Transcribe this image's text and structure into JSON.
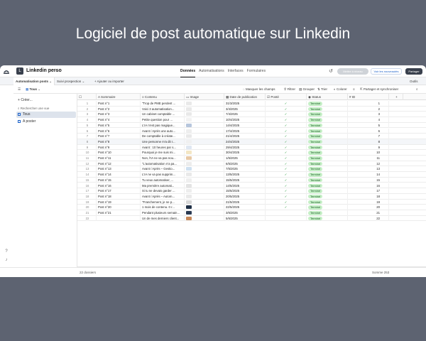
{
  "slide": {
    "title": "Logiciel de post automatique sur Linkedin"
  },
  "topbar": {
    "base_icon": "L",
    "base_name": "Linkedin perso",
    "nav": [
      "Données",
      "Automatisations",
      "Interfaces",
      "Formulaires"
    ],
    "new_button": "Mettre à niveau",
    "news_button": "Voir les nouveautés",
    "share_button": "Partager"
  },
  "tabs": {
    "items": [
      "Automatisation posts",
      "Suivi prospection",
      "Ajouter ou importer"
    ],
    "tools": "Outils"
  },
  "viewbar": {
    "view_name": "Tous",
    "hide_fields": "Masquer les champs",
    "filter": "Filtrer",
    "group": "Grouper",
    "sort": "Trier",
    "color": "Colorer",
    "share_sync": "Partager et synchroniser"
  },
  "sidebar": {
    "create": "Créer...",
    "search": "Rechercher une vue",
    "views": [
      "Tous",
      "A poster"
    ]
  },
  "grid": {
    "headers": [
      "Sommaire",
      "Contenu",
      "Image",
      "Date de publication",
      "Posté",
      "Status",
      "ID"
    ],
    "rows": [
      {
        "n": "1",
        "title": "Post n°1",
        "content": "\"Trop de PME perdent ...",
        "date": "31/3/2025",
        "posted": true,
        "status": "Terminé",
        "id": "1",
        "thumb": "#e9e9e9"
      },
      {
        "n": "2",
        "title": "Post n°2",
        "content": "Voici 3 automatisation...",
        "date": "3/4/2025",
        "posted": true,
        "status": "Terminé",
        "id": "2",
        "thumb": "#e9e9e9"
      },
      {
        "n": "3",
        "title": "Post n°3",
        "content": "Un cabinet comptable ...",
        "date": "7/4/2025",
        "posted": true,
        "status": "Terminé",
        "id": "3",
        "thumb": "#e9e9e9"
      },
      {
        "n": "4",
        "title": "Post n°4",
        "content": "Petite question pour ...",
        "date": "10/4/2025",
        "posted": true,
        "status": "Terminé",
        "id": "4",
        "thumb": "#f2f2f2"
      },
      {
        "n": "5",
        "title": "Post n°5",
        "content": "L'IA n'est pas magique...",
        "date": "14/4/2025",
        "posted": true,
        "status": "Terminé",
        "id": "5",
        "thumb": "#b7c6dd"
      },
      {
        "n": "6",
        "title": "Post n°6",
        "content": "Avant / Après une auto...",
        "date": "17/4/2025",
        "posted": true,
        "status": "Terminé",
        "id": "6",
        "thumb": "#eeeeee"
      },
      {
        "n": "7",
        "title": "Post n°7",
        "content": "De comptable à créate...",
        "date": "21/4/2025",
        "posted": true,
        "status": "Terminé",
        "id": "7",
        "thumb": "#e9e9e9"
      },
      {
        "n": "8",
        "title": "Post n°8",
        "content": "Une personne m'a dit r...",
        "date": "24/4/2025",
        "posted": true,
        "status": "Terminé",
        "id": "8",
        "thumb": "#f0f0f0"
      },
      {
        "n": "9",
        "title": "Post n°9",
        "content": "Avant : 10 heures par s...",
        "date": "29/4/2025",
        "posted": true,
        "status": "Terminé",
        "id": "9",
        "thumb": "#dfe7f2"
      },
      {
        "n": "10",
        "title": "Post n°10",
        "content": "Pourquoi je me suis mi...",
        "date": "30/4/2025",
        "posted": true,
        "status": "Terminé",
        "id": "10",
        "thumb": "#f3e6c4"
      },
      {
        "n": "11",
        "title": "Post n°11",
        "content": "Non, l'IA ne va pas nou...",
        "date": "1/5/2025",
        "posted": true,
        "status": "Terminé",
        "id": "11",
        "thumb": "#e8c9a6"
      },
      {
        "n": "12",
        "title": "Post n°12",
        "content": "\"L'automatisation n'a pa...",
        "date": "6/5/2025",
        "posted": true,
        "status": "Terminé",
        "id": "12",
        "thumb": "#ececec"
      },
      {
        "n": "13",
        "title": "Post n°13",
        "content": "Avant / Après – Gestio...",
        "date": "7/5/2025",
        "posted": true,
        "status": "Terminé",
        "id": "13",
        "thumb": "#cfe0f0"
      },
      {
        "n": "14",
        "title": "Post n°14",
        "content": "L'IA ne va pas supprim...",
        "date": "13/5/2025",
        "posted": true,
        "status": "Terminé",
        "id": "14",
        "thumb": "#e9e9e9"
      },
      {
        "n": "15",
        "title": "Post n°15",
        "content": "Tu veux automatiser, ...",
        "date": "15/5/2025",
        "posted": true,
        "status": "Terminé",
        "id": "15",
        "thumb": "#efefef"
      },
      {
        "n": "16",
        "title": "Post n°16",
        "content": "Ma première automati...",
        "date": "14/5/2025",
        "posted": true,
        "status": "Terminé",
        "id": "16",
        "thumb": "#e3e3e3"
      },
      {
        "n": "17",
        "title": "Post n°17",
        "content": "Si tu ne devais garder ...",
        "date": "15/5/2025",
        "posted": true,
        "status": "Terminé",
        "id": "17",
        "thumb": "#ededed"
      },
      {
        "n": "18",
        "title": "Post n°18",
        "content": "Avant / Après – Autom...",
        "date": "20/5/2025",
        "posted": true,
        "status": "Terminé",
        "id": "18",
        "thumb": "#e9e9e9"
      },
      {
        "n": "19",
        "title": "Post n°19",
        "content": "\"Franchement, je ne p...",
        "date": "21/5/2025",
        "posted": true,
        "status": "Terminé",
        "id": "19",
        "thumb": "#d9d9d9"
      },
      {
        "n": "20",
        "title": "Post n°20",
        "content": "1 mois de contenu. 0 r...",
        "date": "22/5/2025",
        "posted": true,
        "status": "Terminé",
        "id": "20",
        "thumb": "#1f2f45"
      },
      {
        "n": "21",
        "title": "Post n°21",
        "content": "Pendant plusieurs semain...",
        "date": "3/6/2025",
        "posted": false,
        "status": "Terminé",
        "id": "21",
        "thumb": "#2a3a52"
      },
      {
        "n": "22",
        "title": "",
        "content": "Un de mes derniers client...",
        "date": "5/6/2025",
        "posted": false,
        "status": "Terminé",
        "id": "22",
        "thumb": "#c98a5a"
      }
    ],
    "add_label": "Ajouter...",
    "record_count": "22 dossiers",
    "sum": "Somme 253"
  }
}
